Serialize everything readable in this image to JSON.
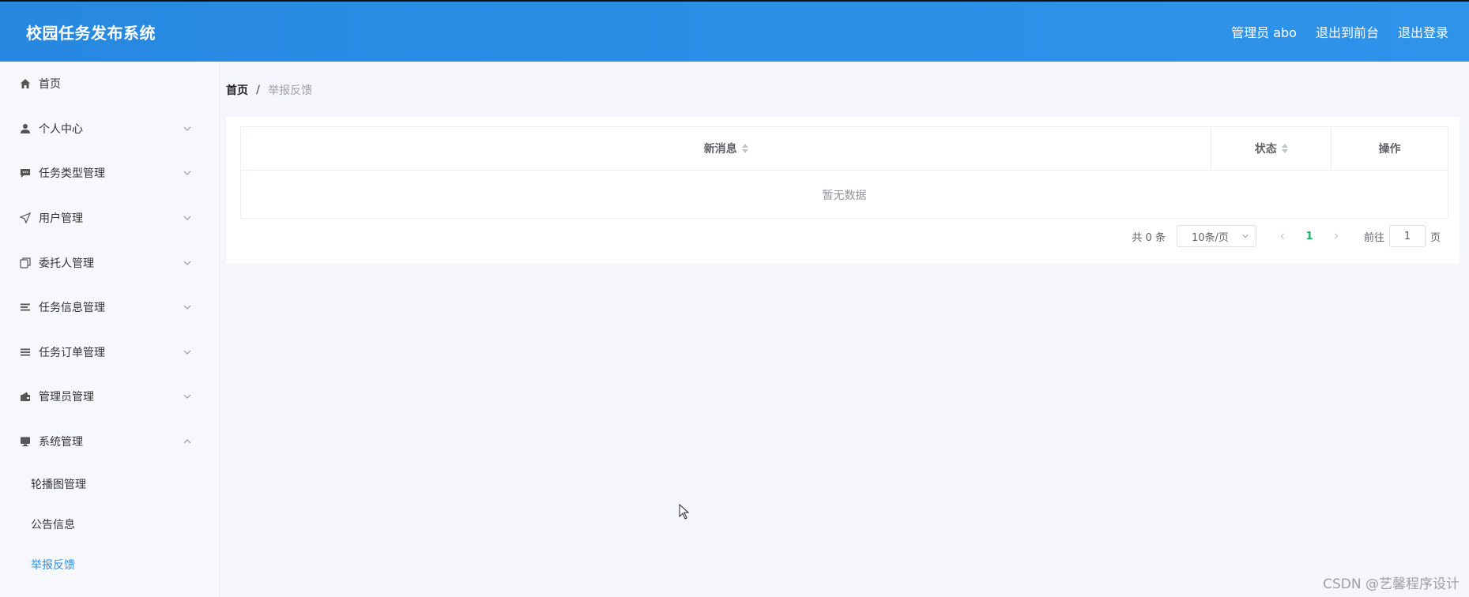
{
  "header": {
    "app_title": "校园任务发布系统",
    "user_label": "管理员 abo",
    "front_link": "退出到前台",
    "logout_link": "退出登录"
  },
  "sidebar": {
    "items": [
      {
        "label": "首页",
        "icon": "home-icon"
      },
      {
        "label": "个人中心",
        "icon": "user-icon"
      },
      {
        "label": "任务类型管理",
        "icon": "chat-icon"
      },
      {
        "label": "用户管理",
        "icon": "send-icon"
      },
      {
        "label": "委托人管理",
        "icon": "copy-icon"
      },
      {
        "label": "任务信息管理",
        "icon": "list-icon"
      },
      {
        "label": "任务订单管理",
        "icon": "menu-icon"
      },
      {
        "label": "管理员管理",
        "icon": "wallet-icon"
      },
      {
        "label": "系统管理",
        "icon": "monitor-icon"
      }
    ],
    "sub_items": [
      {
        "label": "轮播图管理"
      },
      {
        "label": "公告信息"
      },
      {
        "label": "举报反馈"
      }
    ],
    "active_color": "#2b8fe6"
  },
  "breadcrumb": {
    "home": "首页",
    "separator": "/",
    "current": "举报反馈"
  },
  "table": {
    "columns": [
      "新消息",
      "状态",
      "操作"
    ],
    "empty_text": "暂无数据"
  },
  "pagination": {
    "total_text": "共 0 条",
    "page_size": "10条/页",
    "current_page": "1",
    "goto_prefix": "前往",
    "goto_value": "1",
    "goto_suffix": "页"
  },
  "watermark": "CSDN @艺馨程序设计",
  "colors": {
    "header_bg": "#2b8fe6",
    "active_page": "#15b56a"
  }
}
